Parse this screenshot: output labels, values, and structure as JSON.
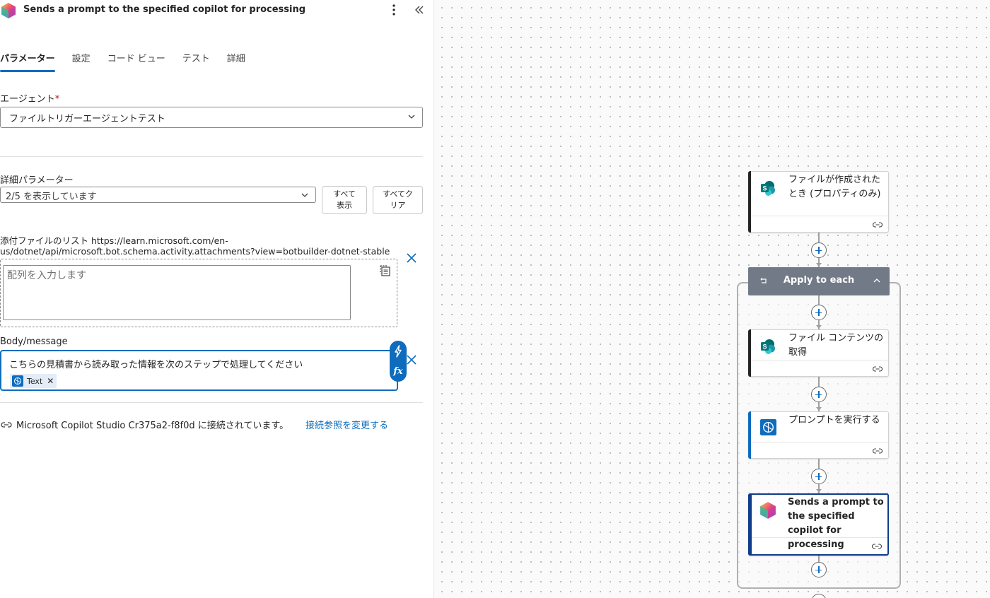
{
  "header": {
    "title": "Sends a prompt to the specified copilot for processing",
    "more_icon": "more-vertical-icon",
    "collapse_icon": "double-chevron-left-icon"
  },
  "tabs": [
    {
      "label": "パラメーター",
      "active": true
    },
    {
      "label": "設定",
      "active": false
    },
    {
      "label": "コード ビュー",
      "active": false
    },
    {
      "label": "テスト",
      "active": false
    },
    {
      "label": "詳細",
      "active": false
    }
  ],
  "agent": {
    "label": "エージェント",
    "required_mark": "*",
    "value": "ファイルトリガーエージェントテスト"
  },
  "advanced": {
    "label": "詳細パラメーター",
    "value": "2/5 を表示しています",
    "show_all_line1": "すべて",
    "show_all_line2": "表示",
    "clear_all_line1": "すべてク",
    "clear_all_line2": "リア"
  },
  "attachments": {
    "label_line1": "添付ファイルのリスト https://learn.microsoft.com/en-",
    "label_line2": "us/dotnet/api/microsoft.bot.schema.activity.attachments?view=botbuilder-dotnet-stable",
    "placeholder": "配列を入力します"
  },
  "body": {
    "label": "Body/message",
    "value": "こちらの見積書から読み取った情報を次のステップで処理してください",
    "token_label": "Text",
    "dynamic_icon": "lightning-icon",
    "fx_label": "fx"
  },
  "connection": {
    "text": "Microsoft Copilot Studio Cr375a2-f8f0d に接続されています。",
    "change_link": "接続参照を変更する"
  },
  "flow": {
    "trigger_title": "ファイルが作成されたとき (プロパティのみ)",
    "loop_title": "Apply to each",
    "get_content_title": "ファイル コンテンツの取得",
    "run_prompt_title": "プロンプトを実行する",
    "copilot_title": "Sends a prompt to the specified copilot for processing"
  },
  "colors": {
    "accent": "#0f6cbd",
    "selected_border": "#0f3c8a",
    "loop_header": "#717a86",
    "sharepoint": "#038387"
  }
}
